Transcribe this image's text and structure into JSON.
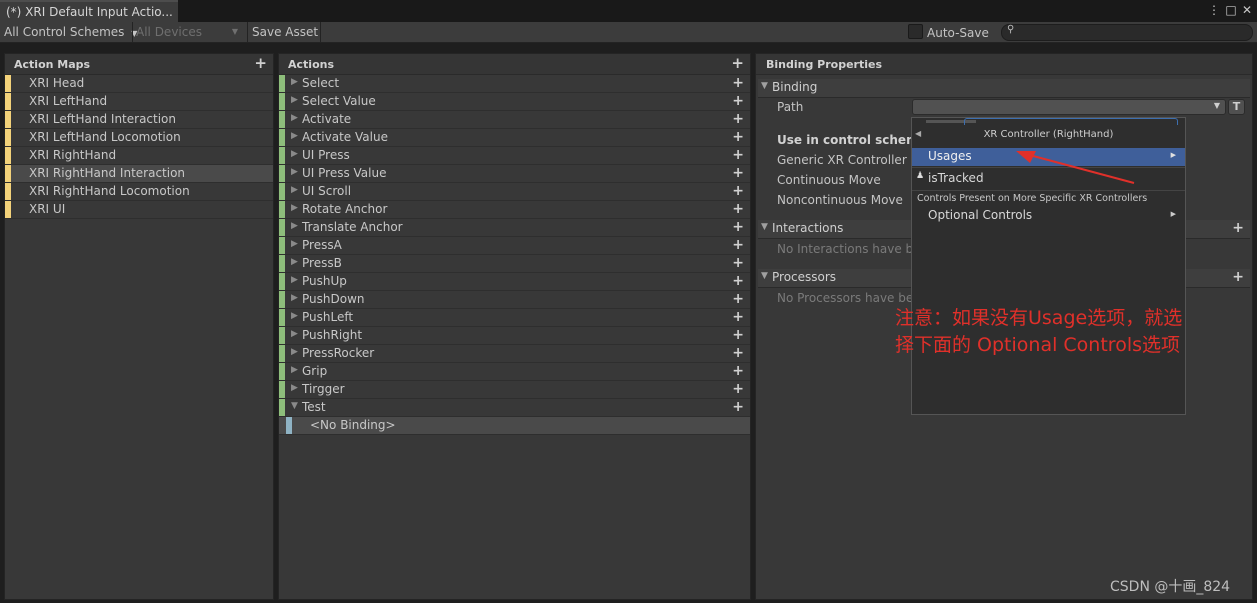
{
  "window": {
    "tab_title": "(*) XRI Default Input Actio...",
    "controls": [
      "⋮",
      "□",
      "✕"
    ]
  },
  "toolbar": {
    "control_schemes": "All Control Schemes",
    "devices": "All Devices",
    "save_asset": "Save Asset",
    "auto_save": "Auto-Save",
    "search_placeholder": ""
  },
  "action_maps": {
    "header": "Action Maps",
    "items": [
      {
        "label": "XRI Head",
        "selected": false
      },
      {
        "label": "XRI LeftHand",
        "selected": false
      },
      {
        "label": "XRI LeftHand Interaction",
        "selected": false
      },
      {
        "label": "XRI LeftHand Locomotion",
        "selected": false
      },
      {
        "label": "XRI RightHand",
        "selected": false
      },
      {
        "label": "XRI RightHand Interaction",
        "selected": true
      },
      {
        "label": "XRI RightHand Locomotion",
        "selected": false
      },
      {
        "label": "XRI UI",
        "selected": false
      }
    ]
  },
  "actions": {
    "header": "Actions",
    "items": [
      "Select",
      "Select Value",
      "Activate",
      "Activate Value",
      "UI Press",
      "UI Press Value",
      "UI Scroll",
      "Rotate Anchor",
      "Translate Anchor",
      "PressA",
      "PressB",
      "PushUp",
      "PushDown",
      "PushLeft",
      "PushRight",
      "PressRocker",
      "Grip",
      "Tirgger",
      "Test"
    ],
    "expanded_index": 18,
    "binding_label": "<No Binding>"
  },
  "binding_properties": {
    "header": "Binding Properties",
    "binding_section": "Binding",
    "path_label": "Path",
    "path_value": "",
    "t_button": "T",
    "use_in_scheme": "Use in control scheme",
    "schemes": [
      "Generic XR Controller",
      "Continuous Move",
      "Noncontinuous Move"
    ],
    "interactions_section": "Interactions",
    "interactions_empty": "No Interactions have bee",
    "processors_section": "Processors",
    "processors_empty": "No Processors have bee"
  },
  "popup": {
    "title": "XR Controller (RightHand)",
    "items": [
      {
        "label": "Usages",
        "selected": true,
        "submenu": true
      },
      {
        "label": "isTracked",
        "selected": false,
        "submenu": false
      }
    ],
    "group_header": "Controls Present on More Specific XR Controllers",
    "optional": "Optional Controls"
  },
  "annotation": {
    "line1": "注意：如果没有Usage选项，就选",
    "line2": "择下面的 Optional Controls选项"
  },
  "watermark": "CSDN @十画_824",
  "colors": {
    "map_bar": "#f3d27a",
    "action_bar": "#8ebe7b",
    "binding_bar": "#8fb3c4",
    "selection": "#4a4a4a",
    "popup_selected": "#3f5f9a",
    "annotation": "#e0302a"
  }
}
